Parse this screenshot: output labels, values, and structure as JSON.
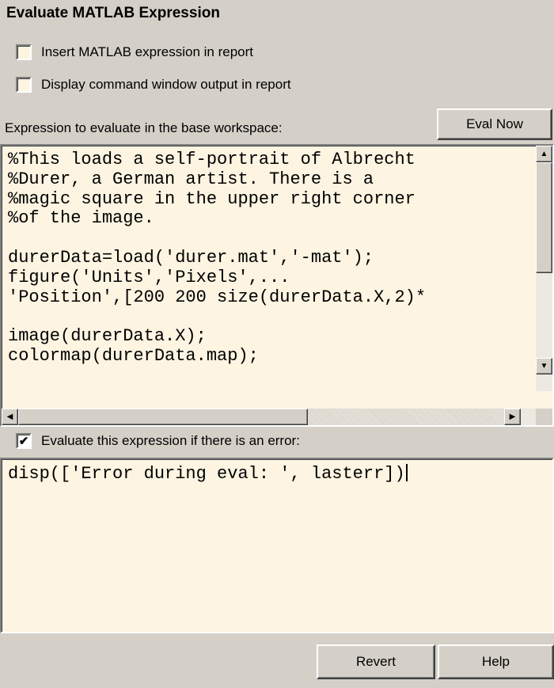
{
  "title": "Evaluate MATLAB Expression",
  "options": {
    "insert_expression": {
      "label": "Insert MATLAB expression in report",
      "checked": false
    },
    "display_output": {
      "label": "Display command window output in report",
      "checked": false
    }
  },
  "expression_label": "Expression to evaluate in the base workspace:",
  "eval_now_label": "Eval Now",
  "expression_lines": [
    "%This loads a self-portrait of Albrecht",
    "%Durer, a German artist. There is a",
    "%magic square in the upper right corner",
    "%of the image.",
    "",
    "durerData=load('durer.mat','-mat');",
    "figure('Units','Pixels',...",
    "'Position',[200 200 size(durerData.X,2)*",
    "",
    "image(durerData.X);",
    "colormap(durerData.map);"
  ],
  "error_option": {
    "label": "Evaluate this expression if there is an error:",
    "checked": true,
    "check_glyph": "✔"
  },
  "error_expression": "disp(['Error during eval: ', lasterr])",
  "buttons": {
    "revert": "Revert",
    "help": "Help"
  },
  "icons": {
    "scroll_up": "▲",
    "scroll_down": "▼",
    "scroll_left": "◀",
    "scroll_right": "▶"
  },
  "colors": {
    "panel_bg": "#d4d0c8",
    "editor_bg": "#fdf4e2"
  }
}
